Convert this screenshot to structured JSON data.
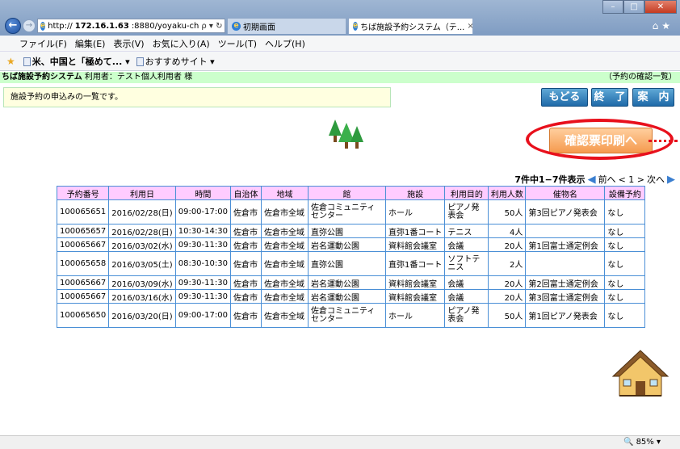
{
  "browser": {
    "address": {
      "prefix": "http://",
      "host": "172.16.1.63",
      "rest": ":8880/yoyaku-ch",
      "controls": "ρ ▾ ↻"
    },
    "tabs": [
      {
        "label": "初期画面"
      },
      {
        "label": "ちば施設予約システム（テ..."
      }
    ],
    "tab_close": "×",
    "menu": [
      "ファイル(F)",
      "編集(E)",
      "表示(V)",
      "お気に入り(A)",
      "ツール(T)",
      "ヘルプ(H)"
    ],
    "favorites": [
      {
        "label": "米、中国と「極めて... ▾"
      },
      {
        "label": "おすすめサイト ▾"
      }
    ],
    "zoom": "🔍 85%   ▾"
  },
  "page": {
    "system_title": "ちば施設予約システム",
    "user_info": "利用者：テスト個人利用者 様",
    "header_link": "（予約の確認一覧）",
    "message": "施設予約の申込みの一覧です。",
    "buttons": {
      "back": "もどる",
      "end": "終　了",
      "guide": "案　内",
      "print": "確認票印刷へ"
    },
    "pager": {
      "count": "7件中1−7件表示",
      "prev": "前へ",
      "pages": "< 1 >",
      "next": "次へ"
    }
  },
  "table": {
    "headers": [
      "予約番号",
      "利用日",
      "時間",
      "自治体",
      "地域",
      "館",
      "施設",
      "利用目的",
      "利用人数",
      "催物名",
      "設備予約"
    ],
    "rows": [
      [
        "100065651",
        "2016/02/28(日)",
        "09:00-17:00",
        "佐倉市",
        "佐倉市全域",
        "佐倉コミュニティセンター",
        "ホール",
        "ピアノ発表会",
        "50人",
        "第3回ピアノ発表会",
        "なし"
      ],
      [
        "100065657",
        "2016/02/28(日)",
        "10:30-14:30",
        "佐倉市",
        "佐倉市全域",
        "直弥公園",
        "直弥1番コート",
        "テニス",
        "4人",
        "",
        "なし"
      ],
      [
        "100065667",
        "2016/03/02(水)",
        "09:30-11:30",
        "佐倉市",
        "佐倉市全域",
        "岩名運動公園",
        "資料館会議室",
        "会議",
        "20人",
        "第1回富士通定例会",
        "なし"
      ],
      [
        "100065658",
        "2016/03/05(土)",
        "08:30-10:30",
        "佐倉市",
        "佐倉市全域",
        "直弥公園",
        "直弥1番コート",
        "ソフトテニス",
        "2人",
        "",
        "なし"
      ],
      [
        "100065667",
        "2016/03/09(水)",
        "09:30-11:30",
        "佐倉市",
        "佐倉市全域",
        "岩名運動公園",
        "資料館会議室",
        "会議",
        "20人",
        "第2回富士通定例会",
        "なし"
      ],
      [
        "100065667",
        "2016/03/16(水)",
        "09:30-11:30",
        "佐倉市",
        "佐倉市全域",
        "岩名運動公園",
        "資料館会議室",
        "会議",
        "20人",
        "第3回富士通定例会",
        "なし"
      ],
      [
        "100065650",
        "2016/03/20(日)",
        "09:00-17:00",
        "佐倉市",
        "佐倉市全域",
        "佐倉コミュニティセンター",
        "ホール",
        "ピアノ発表会",
        "50人",
        "第1回ピアノ発表会",
        "なし"
      ]
    ]
  },
  "colors": {
    "header_band": "#ccffcc",
    "table_header": "#ffccff",
    "table_border": "#4a8fd6",
    "highlight_ring": "#e8101c"
  }
}
